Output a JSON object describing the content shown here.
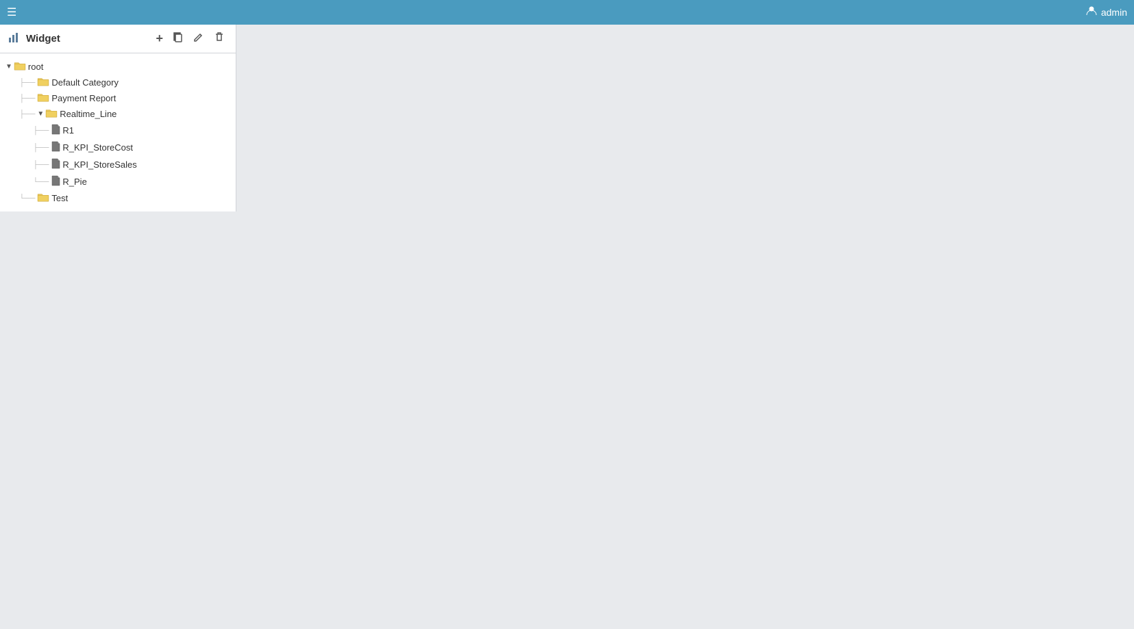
{
  "navbar": {
    "hamburger_label": "☰",
    "user_icon_label": "👤",
    "admin_label": "admin",
    "bg_color": "#4a9bbf"
  },
  "sidebar": {
    "title": "Widget",
    "title_icon": "📊",
    "actions": {
      "add_label": "+",
      "copy_label": "⧉",
      "edit_label": "✎",
      "delete_label": "🗑"
    }
  },
  "tree": {
    "items": [
      {
        "id": "root",
        "label": "root",
        "type": "folder",
        "level": 0,
        "toggle": "▼",
        "has_toggle": true
      },
      {
        "id": "default-category",
        "label": "Default Category",
        "type": "folder",
        "level": 1,
        "has_toggle": false
      },
      {
        "id": "payment-report",
        "label": "Payment Report",
        "type": "folder",
        "level": 1,
        "has_toggle": false
      },
      {
        "id": "realtime-line",
        "label": "Realtime_Line",
        "type": "folder",
        "level": 1,
        "has_toggle": true,
        "toggle": "▼"
      },
      {
        "id": "r1",
        "label": "R1",
        "type": "file",
        "level": 2,
        "has_toggle": false
      },
      {
        "id": "r-kpi-storecost",
        "label": "R_KPI_StoreCost",
        "type": "file",
        "level": 2,
        "has_toggle": false
      },
      {
        "id": "r-kpi-storesales",
        "label": "R_KPI_StoreSales",
        "type": "file",
        "level": 2,
        "has_toggle": false
      },
      {
        "id": "r-pie",
        "label": "R_Pie",
        "type": "file",
        "level": 2,
        "has_toggle": false
      },
      {
        "id": "test",
        "label": "Test",
        "type": "folder",
        "level": 1,
        "has_toggle": false
      }
    ]
  }
}
